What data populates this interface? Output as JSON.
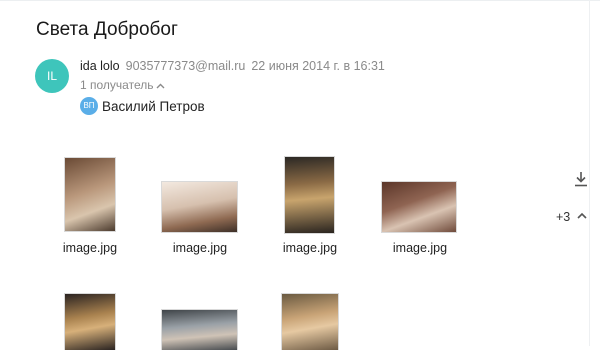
{
  "message": {
    "subject": "Света Добробог",
    "sender": {
      "avatar_initials": "IL",
      "avatar_color": "#3ec5bb",
      "name": "ida lolo",
      "email": "9035777373@mail.ru"
    },
    "date": "22 июня 2014 г. в 16:31",
    "recipients_toggle": "1 получатель",
    "recipient": {
      "avatar_initials": "ВП",
      "avatar_color": "#5aaee8",
      "name": "Василий Петров"
    }
  },
  "attachments": {
    "items": [
      {
        "name": "image.jpg",
        "icon": "photo"
      },
      {
        "name": "image.jpg",
        "icon": "photo"
      },
      {
        "name": "image.jpg",
        "icon": "photo"
      },
      {
        "name": "image.jpg",
        "icon": "photo"
      },
      {
        "icon": "photo"
      },
      {
        "icon": "photo"
      },
      {
        "icon": "photo"
      }
    ],
    "more_count": "+3",
    "download_icon": "download-icon",
    "collapse_icon": "chevron-up-icon"
  }
}
